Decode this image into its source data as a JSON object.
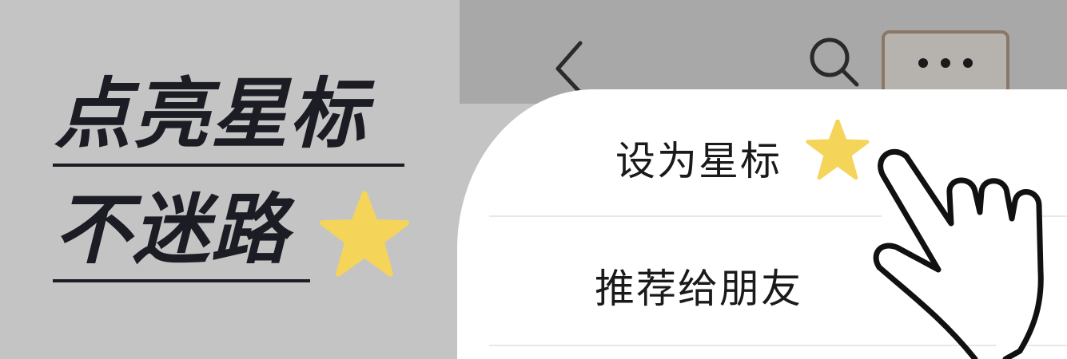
{
  "promo": {
    "line1": "点亮星标",
    "line2": "不迷路",
    "star_color": "#f5d45a"
  },
  "header": {
    "back_icon": "chevron-left-icon",
    "search_icon": "search-icon",
    "more_icon": "more-dots-icon"
  },
  "menu": {
    "items": [
      {
        "label": "设为星标",
        "icon": "star-icon"
      },
      {
        "label": "推荐给朋友"
      }
    ]
  },
  "pointer": {
    "icon": "pointing-hand-icon"
  }
}
